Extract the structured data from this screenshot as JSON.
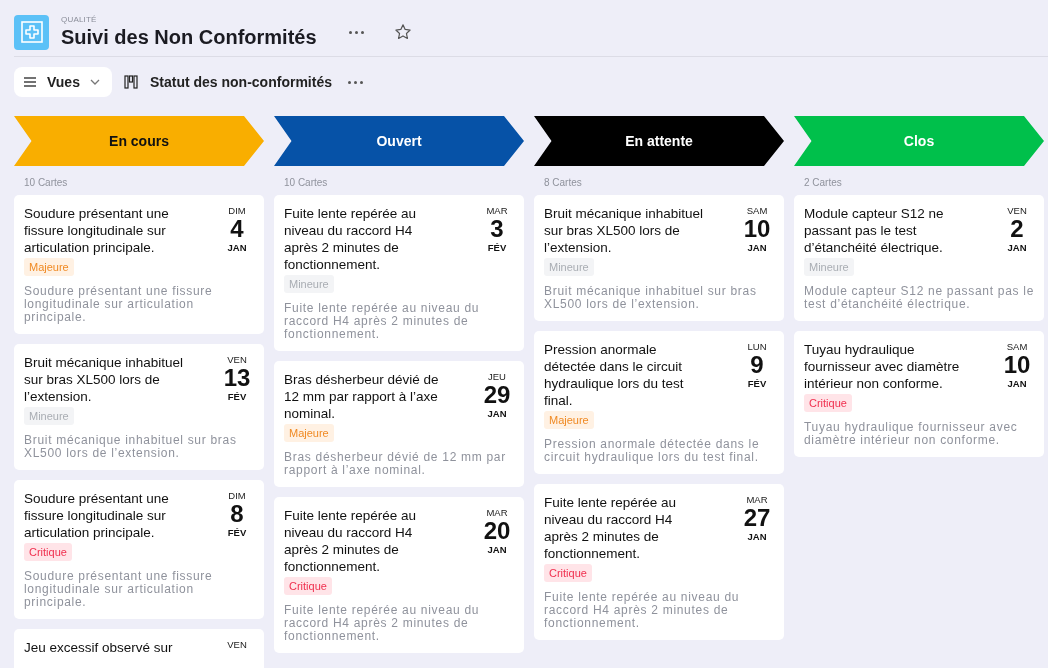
{
  "header": {
    "section": "QUALITÉ",
    "title": "Suivi des Non Conformités"
  },
  "toolbar": {
    "views_label": "Vues",
    "board_label": "Statut des non-conformités"
  },
  "columns": [
    {
      "name": "En cours",
      "color": "#f9ae00",
      "count": "10 Cartes",
      "cards": [
        {
          "title": "Soudure présentant une fissure longitudinale sur articulation principale.",
          "dow": "DIM",
          "day": "4",
          "month": "JAN",
          "badge": {
            "label": "Majeure",
            "kind": "major"
          },
          "description": "Soudure présentant une fissure longitudinale sur articulation principale."
        },
        {
          "title": "Bruit mécanique inhabituel sur bras XL500 lors de l’extension.",
          "dow": "VEN",
          "day": "13",
          "month": "FÉV",
          "badge": {
            "label": "Mineure",
            "kind": "minor"
          },
          "description": "Bruit mécanique inhabituel sur bras XL500 lors de l’extension."
        },
        {
          "title": "Soudure présentant une fissure longitudinale sur articulation principale.",
          "dow": "DIM",
          "day": "8",
          "month": "FÉV",
          "badge": {
            "label": "Critique",
            "kind": "critical"
          },
          "description": "Soudure présentant une fissure longitudinale sur articulation principale."
        },
        {
          "title": "Jeu excessif observé sur",
          "dow": "VEN"
        }
      ]
    },
    {
      "name": "Ouvert",
      "color": "#0652a7",
      "count": "10 Cartes",
      "cards": [
        {
          "title": "Fuite lente repérée au niveau du raccord H4 après 2 minutes de fonctionnement.",
          "dow": "MAR",
          "day": "3",
          "month": "FÉV",
          "badge": {
            "label": "Mineure",
            "kind": "minor"
          },
          "description": "Fuite lente repérée au niveau du raccord H4 après 2 minutes de fonctionnement."
        },
        {
          "title": "Bras désherbeur dévié de 12 mm par rapport à l’axe nominal.",
          "dow": "JEU",
          "day": "29",
          "month": "JAN",
          "badge": {
            "label": "Majeure",
            "kind": "major"
          },
          "description": "Bras désherbeur dévié de 12 mm par rapport à l’axe nominal."
        },
        {
          "title": "Fuite lente repérée au niveau du raccord H4 après 2 minutes de fonctionnement.",
          "dow": "MAR",
          "day": "20",
          "month": "JAN",
          "badge": {
            "label": "Critique",
            "kind": "critical"
          },
          "description": "Fuite lente repérée au niveau du raccord H4 après 2 minutes de fonctionnement."
        }
      ]
    },
    {
      "name": "En attente",
      "color": "#000000",
      "count": "8 Cartes",
      "cards": [
        {
          "title": "Bruit mécanique inhabituel sur bras XL500 lors de l’extension.",
          "dow": "SAM",
          "day": "10",
          "month": "JAN",
          "badge": {
            "label": "Mineure",
            "kind": "minor"
          },
          "description": "Bruit mécanique inhabituel sur bras XL500 lors de l’extension."
        },
        {
          "title": "Pression anormale détectée dans le circuit hydraulique lors du test final.",
          "dow": "LUN",
          "day": "9",
          "month": "FÉV",
          "badge": {
            "label": "Majeure",
            "kind": "major"
          },
          "description": "Pression anormale détectée dans le circuit hydraulique lors du test final."
        },
        {
          "title": "Fuite lente repérée au niveau du raccord H4 après 2 minutes de fonctionnement.",
          "dow": "MAR",
          "day": "27",
          "month": "JAN",
          "badge": {
            "label": "Critique",
            "kind": "critical"
          },
          "description": "Fuite lente repérée au niveau du raccord H4 après 2 minutes de fonctionnement."
        }
      ]
    },
    {
      "name": "Clos",
      "color": "#00c04b",
      "count": "2 Cartes",
      "cards": [
        {
          "title": "Module capteur S12 ne passant pas le test d’étanchéité électrique.",
          "dow": "VEN",
          "day": "2",
          "month": "JAN",
          "badge": {
            "label": "Mineure",
            "kind": "minor"
          },
          "description": "Module capteur S12 ne passant pas le test d’étanchéité électrique."
        },
        {
          "title": "Tuyau hydraulique fournisseur avec diamètre intérieur non conforme.",
          "dow": "SAM",
          "day": "10",
          "month": "JAN",
          "badge": {
            "label": "Critique",
            "kind": "critical"
          },
          "description": "Tuyau hydraulique fournisseur avec diamètre intérieur non conforme."
        }
      ]
    }
  ]
}
